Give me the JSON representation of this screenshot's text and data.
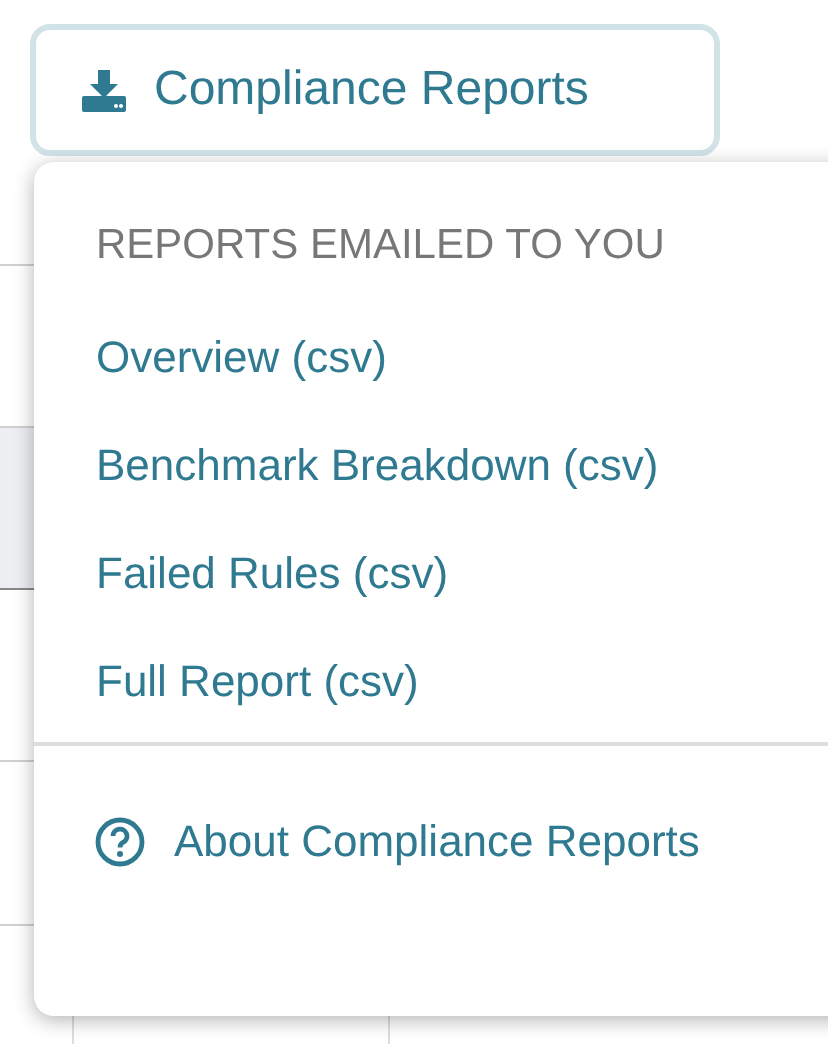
{
  "button": {
    "label": "Compliance Reports"
  },
  "menu": {
    "header": "REPORTS EMAILED TO YOU",
    "items": [
      {
        "label": "Overview (csv)"
      },
      {
        "label": "Benchmark Breakdown (csv)"
      },
      {
        "label": "Failed Rules (csv)"
      },
      {
        "label": "Full Report (csv)"
      }
    ],
    "footer": {
      "label": "About Compliance Reports"
    }
  }
}
